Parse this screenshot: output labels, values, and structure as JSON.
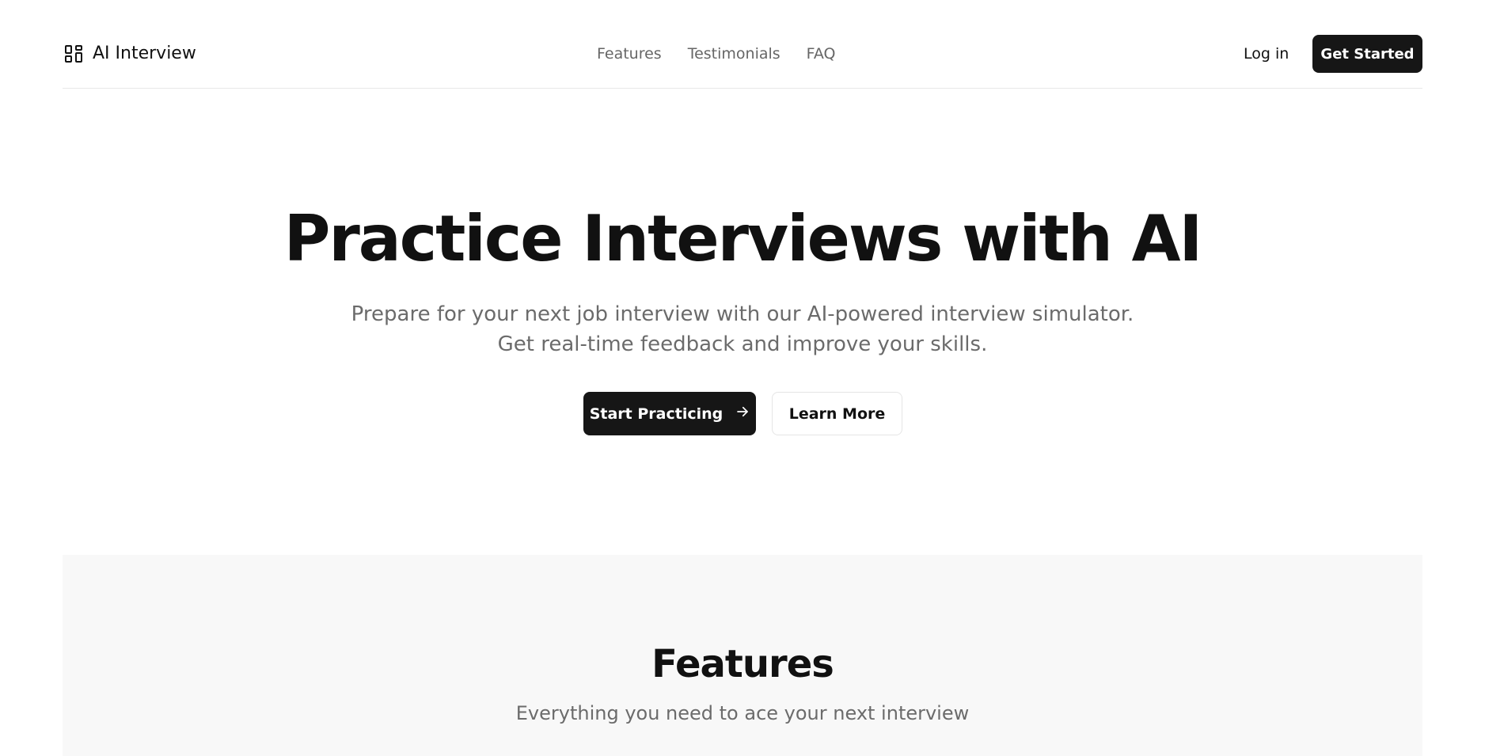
{
  "header": {
    "brand": "AI Interview",
    "nav": [
      "Features",
      "Testimonials",
      "FAQ"
    ],
    "login": "Log in",
    "cta": "Get Started"
  },
  "hero": {
    "title": "Practice Interviews with AI",
    "subtitle_line1": "Prepare for your next job interview with our AI-powered interview simulator.",
    "subtitle_line2": "Get real-time feedback and improve your skills.",
    "primary_button": "Start Practicing",
    "secondary_button": "Learn More"
  },
  "features": {
    "title": "Features",
    "subtitle": "Everything you need to ace your next interview"
  },
  "icons": {
    "brand": "layout-grid-icon",
    "primary_button": "arrow-right-icon"
  },
  "colors": {
    "accent": "#161616",
    "text": "#111111",
    "muted": "#6b6b6b",
    "features_bg": "#f8f8f8"
  }
}
